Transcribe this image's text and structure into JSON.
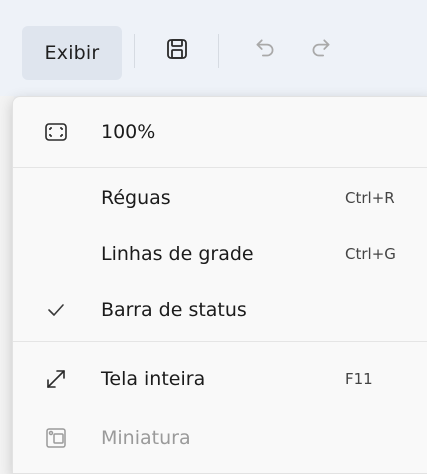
{
  "toolbar": {
    "exibir_label": "Exibir",
    "icons": [
      "save-icon",
      "undo-icon",
      "redo-icon"
    ]
  },
  "menu": {
    "items": [
      {
        "label": "100%",
        "shortcut": "",
        "icon": "fit-to-window-icon",
        "checked": false,
        "disabled": false
      },
      {
        "label": "Réguas",
        "shortcut": "Ctrl+R",
        "icon": "",
        "checked": false,
        "disabled": false
      },
      {
        "label": "Linhas de grade",
        "shortcut": "Ctrl+G",
        "icon": "",
        "checked": false,
        "disabled": false
      },
      {
        "label": "Barra de status",
        "shortcut": "",
        "icon": "checkmark-icon",
        "checked": true,
        "disabled": false
      },
      {
        "label": "Tela inteira",
        "shortcut": "F11",
        "icon": "fullscreen-icon",
        "checked": false,
        "disabled": false
      },
      {
        "label": "Miniatura",
        "shortcut": "",
        "icon": "thumbnail-icon",
        "checked": false,
        "disabled": true
      }
    ]
  },
  "colors": {
    "menu_bg": "#f9f9f9",
    "toolbar_bg": "#eef2f8",
    "active_tab_bg": "#dfe5ee",
    "disabled_text": "#9a9a9a"
  }
}
